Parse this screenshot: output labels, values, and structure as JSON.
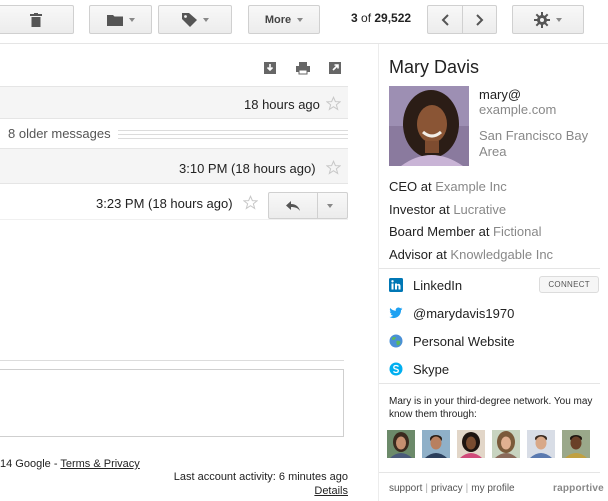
{
  "toolbar": {
    "more_label": "More",
    "counter_current": "3",
    "counter_of": " of ",
    "counter_total": "29,522"
  },
  "thread": {
    "message_1_time": "18 hours ago",
    "older_messages": "8 older messages",
    "message_2_time": "3:10 PM (18 hours ago)",
    "message_3_time": "3:23 PM (18 hours ago)"
  },
  "footer": {
    "copyright": "14 Google - ",
    "terms_link": "Terms & Privacy",
    "last_activity": "Last account activity: 6 minutes ago",
    "details_link": "Details"
  },
  "contact": {
    "name": "Mary Davis",
    "email_user": "mary@",
    "email_domain": "example.com",
    "location": "San Francisco Bay Area",
    "roles": [
      {
        "title": "CEO at ",
        "org": "Example Inc"
      },
      {
        "title": "Investor at ",
        "org": "Lucrative"
      },
      {
        "title": "Board Member at ",
        "org": "Fictional"
      },
      {
        "title": "Advisor at ",
        "org": "Knowledgable Inc"
      }
    ],
    "linkedin_label": "LinkedIn",
    "connect_label": "CONNECT",
    "twitter_handle": "@marydavis1970",
    "website_label": "Personal Website",
    "skype_label": "Skype",
    "network_text": "Mary is in your third-degree network. You may know them through:",
    "footer_support": "support",
    "footer_privacy": "privacy",
    "footer_profile": "my profile",
    "brand": "rapportive"
  },
  "colors": {
    "link_gray": "#888888",
    "linkedin_blue": "#0077b5",
    "twitter_blue": "#1da1f2",
    "skype_blue": "#00aff0"
  }
}
